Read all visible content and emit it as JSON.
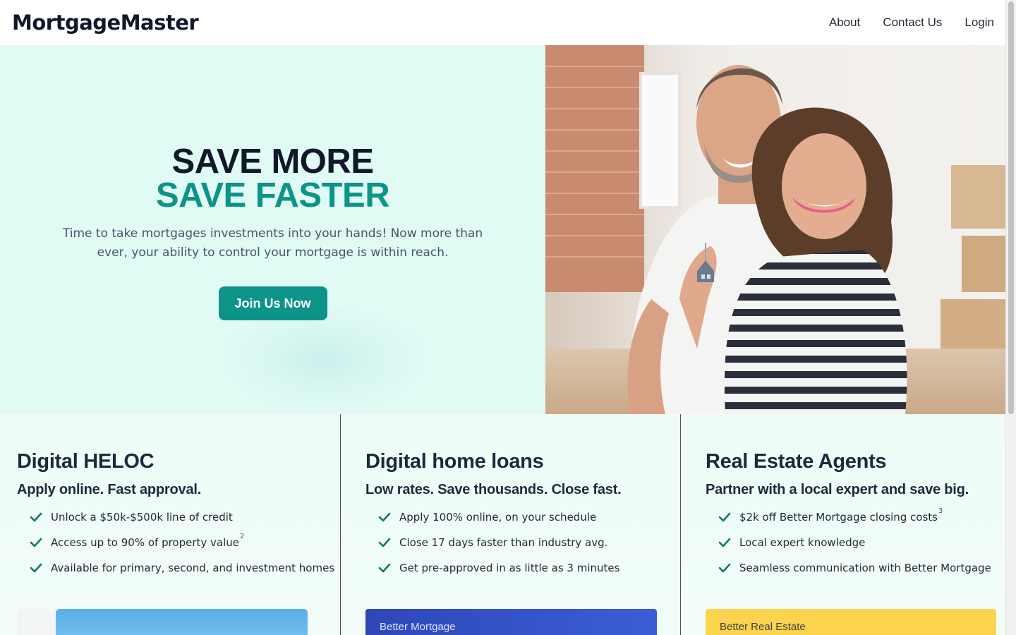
{
  "header": {
    "logo": "MortgageMaster",
    "nav": [
      "About",
      "Contact Us",
      "Login"
    ]
  },
  "hero": {
    "headline_line1": "SAVE MORE",
    "headline_line2": "SAVE FASTER",
    "subtitle": "Time to take mortgages investments into your hands! Now more than ever, your ability to control your mortgage is within reach.",
    "cta_label": "Join Us Now",
    "image_icon": "couple-holding-house-keys-photo"
  },
  "features": [
    {
      "title": "Digital HELOC",
      "subtitle": "Apply online. Fast approval.",
      "items": [
        {
          "text": "Unlock a $50k-$500k line of credit",
          "sup": ""
        },
        {
          "text": "Access up to 90% of property value",
          "sup": "2"
        },
        {
          "text": "Available for primary, second, and investment homes",
          "sup": ""
        }
      ],
      "card_label": ""
    },
    {
      "title": "Digital home loans",
      "subtitle": "Low rates. Save thousands. Close fast.",
      "items": [
        {
          "text": "Apply 100% online, on your schedule",
          "sup": ""
        },
        {
          "text": "Close 17 days faster than industry avg.",
          "sup": ""
        },
        {
          "text": "Get pre-approved in as little as 3 minutes",
          "sup": ""
        }
      ],
      "card_label": "Better Mortgage"
    },
    {
      "title": "Real Estate Agents",
      "subtitle": "Partner with a local expert and save big.",
      "items": [
        {
          "text": "$2k off Better Mortgage closing costs",
          "sup": "3"
        },
        {
          "text": "Local expert knowledge",
          "sup": ""
        },
        {
          "text": "Seamless communication with Better Mortgage",
          "sup": ""
        }
      ],
      "card_label": "Better Real Estate"
    }
  ],
  "colors": {
    "accent": "#0d9488",
    "hero_bg": "#e0faf4",
    "text_dark": "#111827"
  }
}
